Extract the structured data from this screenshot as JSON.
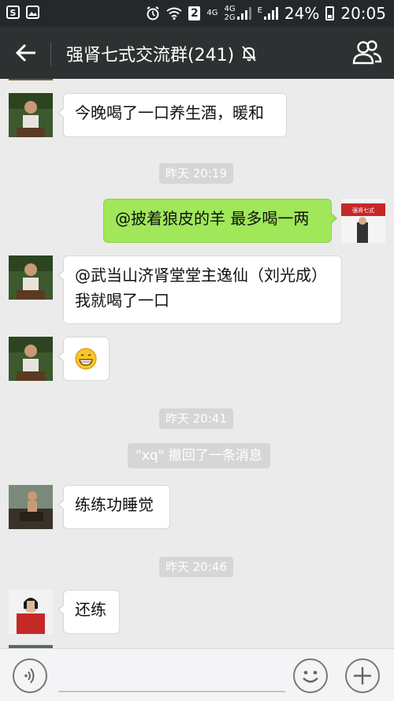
{
  "status_bar": {
    "sim_slot": "2",
    "network_1": "4G",
    "network_2a": "4G",
    "network_2b": "2G",
    "data_type": "E",
    "battery": "24%",
    "time": "20:05"
  },
  "header": {
    "title": "强肾七式交流群(241)",
    "icons": [
      "back-arrow-icon",
      "mute-bell-icon",
      "group-members-icon"
    ]
  },
  "messages": [
    {
      "type": "incoming",
      "text": "今晚喝了一口养生酒，暖和"
    },
    {
      "type": "time",
      "text": "昨天 20:19"
    },
    {
      "type": "outgoing",
      "text": "@披着狼皮的羊 最多喝一两"
    },
    {
      "type": "incoming",
      "line1": "@武当山济肾堂堂主逸仙（刘光成）",
      "line2": "我就喝了一口"
    },
    {
      "type": "incoming",
      "emoji": "grinning-face-emoji"
    },
    {
      "type": "time",
      "text": "昨天 20:41"
    },
    {
      "type": "system",
      "text": "\"xq\" 撤回了一条消息"
    },
    {
      "type": "incoming",
      "text": "练练功睡觉"
    },
    {
      "type": "time",
      "text": "昨天 20:46"
    },
    {
      "type": "incoming",
      "text": "还练"
    }
  ],
  "input_bar": {
    "icons": [
      "voice-input-icon",
      "emoji-icon",
      "plus-icon"
    ]
  }
}
